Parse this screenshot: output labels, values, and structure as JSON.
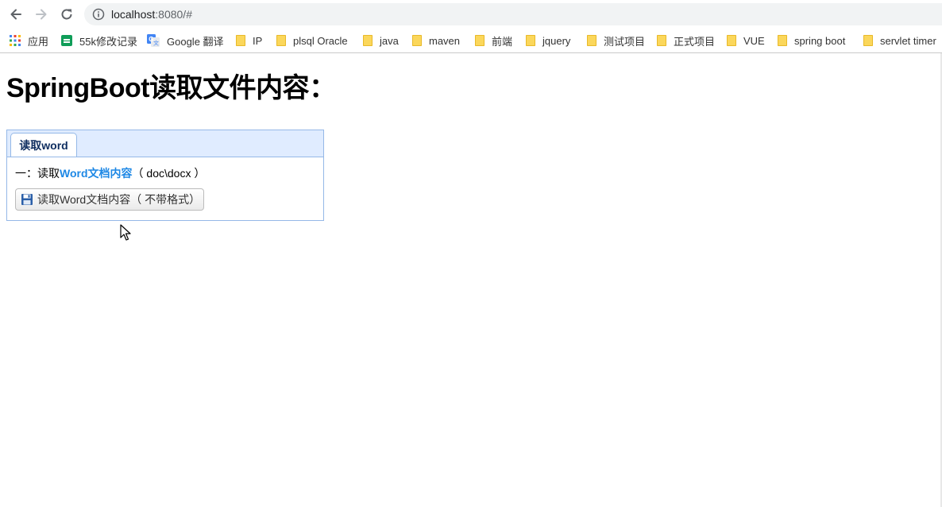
{
  "browser": {
    "url_host": "localhost",
    "url_path": ":8080/#",
    "bookmarks": [
      {
        "label": "应用",
        "icon": "apps-grid-icon"
      },
      {
        "label": "55k修改记录",
        "icon": "sheet-icon"
      },
      {
        "label": "Google 翻译",
        "icon": "google-translate-icon"
      },
      {
        "label": "IP",
        "icon": "folder-icon"
      },
      {
        "label": "plsql Oracle",
        "icon": "folder-icon"
      },
      {
        "label": "java",
        "icon": "folder-icon"
      },
      {
        "label": "maven",
        "icon": "folder-icon"
      },
      {
        "label": "前端",
        "icon": "folder-icon"
      },
      {
        "label": "jquery",
        "icon": "folder-icon"
      },
      {
        "label": "测试项目",
        "icon": "folder-icon"
      },
      {
        "label": "正式项目",
        "icon": "folder-icon"
      },
      {
        "label": "VUE",
        "icon": "folder-icon"
      },
      {
        "label": "spring boot",
        "icon": "folder-icon"
      },
      {
        "label": "servlet timer",
        "icon": "folder-icon"
      }
    ]
  },
  "page": {
    "title": "SpringBoot读取文件内容：",
    "tab_label": "读取word",
    "desc_prefix": "一：读取",
    "desc_highlight": "Word文档内容",
    "desc_suffix": "（ doc\\docx ）",
    "button_label": "读取Word文档内容（ 不带格式）"
  },
  "colors": {
    "panel_border": "#95b8e7",
    "tab_header_bg": "#e0ecff",
    "highlight": "#1e88e5"
  }
}
